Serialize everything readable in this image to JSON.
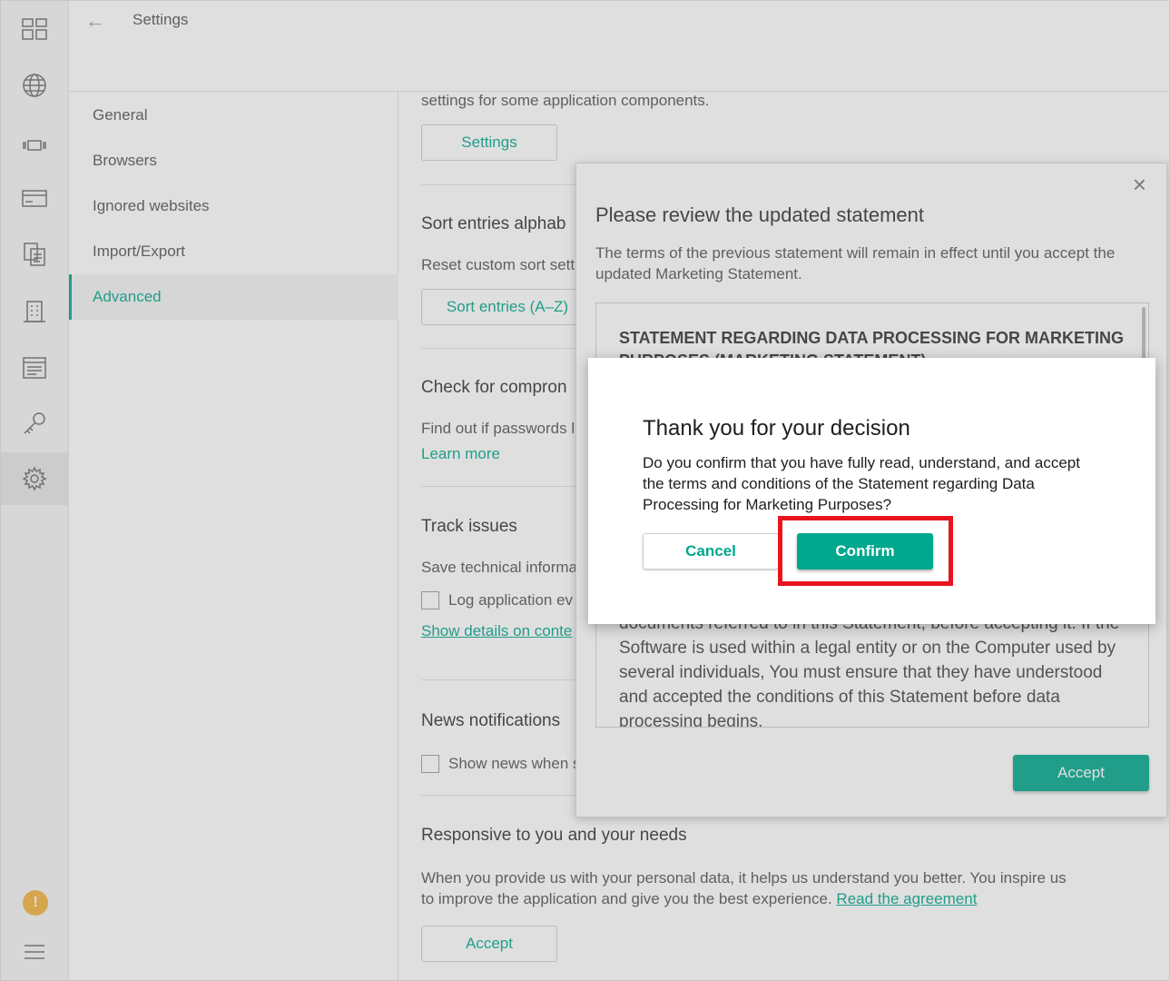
{
  "header": {
    "title": "Settings"
  },
  "rail": {
    "icons": [
      "dashboard-icon",
      "globe-icon",
      "card-icon",
      "wallet-icon",
      "documents-icon",
      "building-icon",
      "notes-icon",
      "key-icon",
      "gear-icon"
    ],
    "warning_badge": "!"
  },
  "nav": {
    "items": [
      {
        "label": "General"
      },
      {
        "label": "Browsers"
      },
      {
        "label": "Ignored websites"
      },
      {
        "label": "Import/Export"
      },
      {
        "label": "Advanced"
      }
    ]
  },
  "main": {
    "intro_text": "settings for some application components.",
    "settings_button": "Settings",
    "sort": {
      "heading": "Sort entries alphab",
      "text": "Reset custom sort sett",
      "button": "Sort entries (A–Z)"
    },
    "compromised": {
      "heading": "Check for compron",
      "text": "Find out if passwords l",
      "link": "Learn more"
    },
    "track": {
      "heading": "Track issues",
      "text": "Save technical informa",
      "checkbox_label": "Log application ev",
      "link": "Show details on conte"
    },
    "news": {
      "heading": "News notifications",
      "checkbox_label": "Show news when s"
    },
    "responsive": {
      "heading": "Responsive to you and your needs",
      "text_line1": "When you provide us with your personal data, it helps us understand you better. You inspire us",
      "text_line2": "to improve the application and give you the best experience.",
      "link": "Read the agreement",
      "button": "Accept"
    }
  },
  "statement_dialog": {
    "close": "×",
    "title": "Please review the updated statement",
    "description": "The terms of the previous statement will remain in effect until you accept the updated Marketing Statement.",
    "box_heading": "STATEMENT REGARDING DATA PROCESSING FOR MARKETING PURPOSES (MARKETING STATEMENT)",
    "box_body": "documents referred to in this Statement, before accepting it. If the Software is used within a legal entity or on the Computer used by several individuals, You must ensure that they have understood and accepted the conditions of this Statement before data processing begins.",
    "accept_button": "Accept"
  },
  "confirm_dialog": {
    "title": "Thank you for your decision",
    "text": "Do you confirm that you have fully read, understand, and accept the terms and conditions of the Statement regarding Data Processing for Marketing Purposes?",
    "cancel_button": "Cancel",
    "confirm_button": "Confirm"
  }
}
